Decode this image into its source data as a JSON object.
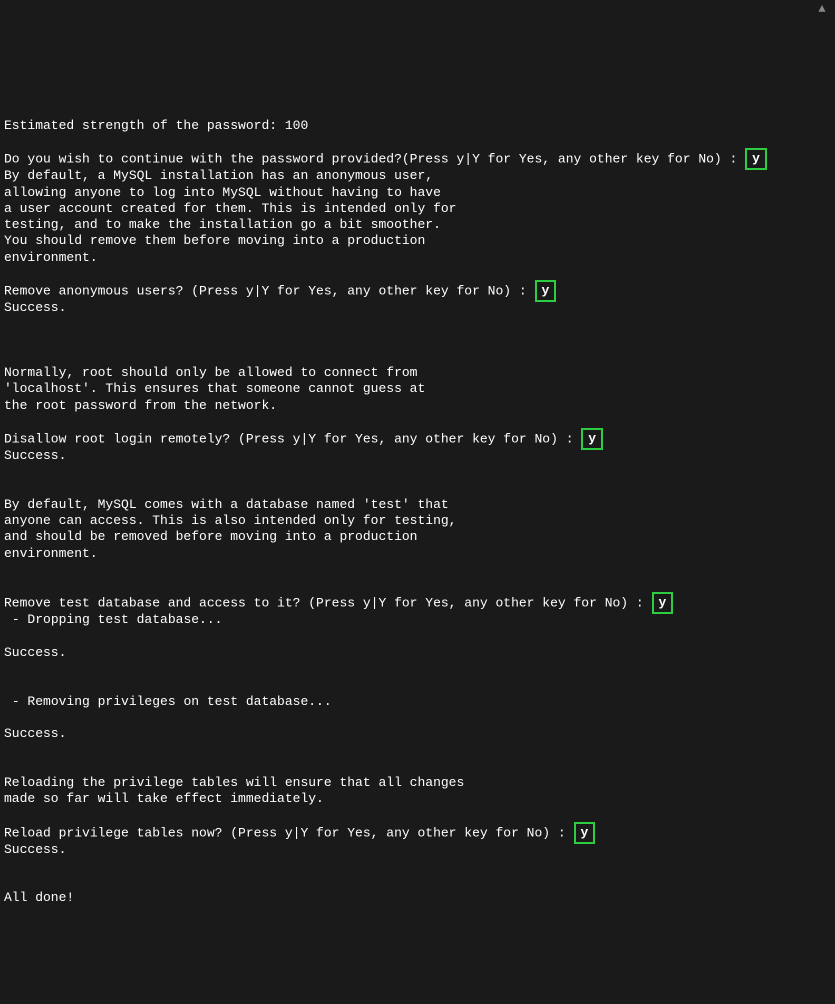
{
  "terminal": {
    "strength_line": "Estimated strength of the password: 100",
    "continue_prompt": "Do you wish to continue with the password provided?(Press y|Y for Yes, any other key for No) : ",
    "continue_answer": "y",
    "anon_block": "By default, a MySQL installation has an anonymous user,\nallowing anyone to log into MySQL without having to have\na user account created for them. This is intended only for\ntesting, and to make the installation go a bit smoother.\nYou should remove them before moving into a production\nenvironment.\n",
    "remove_anon_prompt": "Remove anonymous users? (Press y|Y for Yes, any other key for No) : ",
    "remove_anon_answer": "y",
    "success1": "Success.",
    "root_block": "Normally, root should only be allowed to connect from\n'localhost'. This ensures that someone cannot guess at\nthe root password from the network.\n",
    "disallow_root_prompt": "Disallow root login remotely? (Press y|Y for Yes, any other key for No) : ",
    "disallow_root_answer": "y",
    "success2": "Success.",
    "test_db_block": "By default, MySQL comes with a database named 'test' that\nanyone can access. This is also intended only for testing,\nand should be removed before moving into a production\nenvironment.\n",
    "remove_test_prompt": "Remove test database and access to it? (Press y|Y for Yes, any other key for No) : ",
    "remove_test_answer": "y",
    "dropping_line": " - Dropping test database...",
    "success3": "Success.",
    "removing_priv_line": " - Removing privileges on test database...",
    "success4": "Success.",
    "reload_block": "Reloading the privilege tables will ensure that all changes\nmade so far will take effect immediately.\n",
    "reload_prompt": "Reload privilege tables now? (Press y|Y for Yes, any other key for No) : ",
    "reload_answer": "y",
    "success5": "Success.",
    "all_done": "All done!"
  },
  "scroll_glyph": "▲"
}
